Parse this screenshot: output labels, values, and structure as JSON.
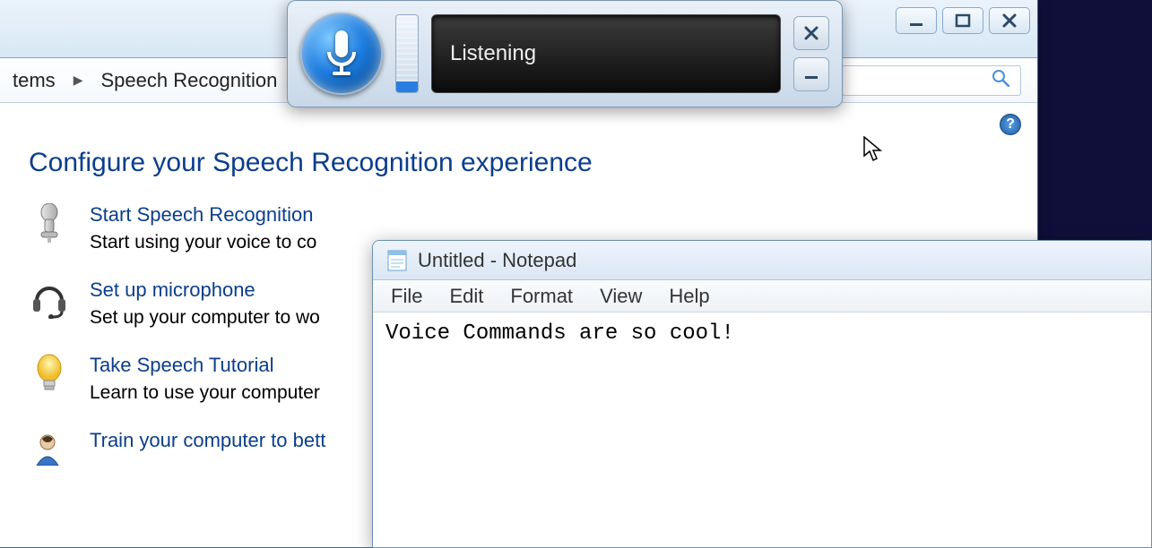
{
  "cp": {
    "breadcrumb": {
      "part1": "tems",
      "part2": "Speech Recognition"
    },
    "heading": "Configure your Speech Recognition experience",
    "items": [
      {
        "link": "Start Speech Recognition",
        "desc": "Start using your voice to co"
      },
      {
        "link": "Set up microphone",
        "desc": "Set up your computer to wo"
      },
      {
        "link": "Take Speech Tutorial",
        "desc": "Learn to use your computer"
      },
      {
        "link": "Train your computer to bett",
        "desc": ""
      }
    ]
  },
  "widget": {
    "status": "Listening"
  },
  "notepad": {
    "title": "Untitled - Notepad",
    "menu": [
      "File",
      "Edit",
      "Format",
      "View",
      "Help"
    ],
    "content": "Voice Commands are so cool!"
  }
}
